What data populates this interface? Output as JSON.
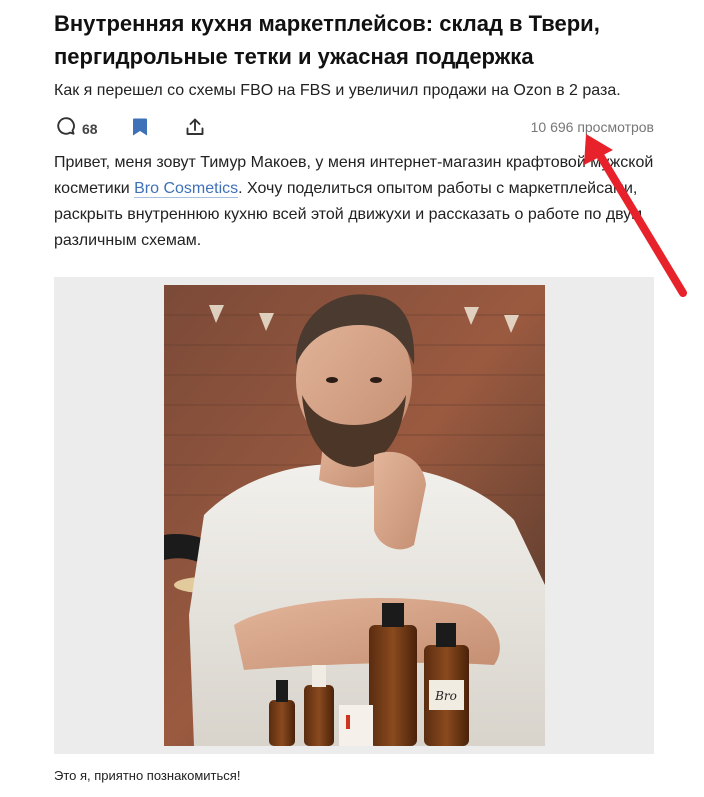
{
  "article": {
    "title": "Внутренняя кухня маркетплейсов: склад в Твери, пергидрольные тетки и ужасная поддержка",
    "subtitle": "Как я перешел со схемы FBO на FBS и увеличил продажи на Ozon в 2 раза.",
    "comments_count": "68",
    "views": "10 696 просмотров",
    "intro_before_link": "Привет, меня зовут Тимур Макоев, у меня интернет-магазин крафтовой мужской косметики ",
    "link_text": "Bro Cosmetics",
    "intro_after_link": ". Хочу поделиться опытом работы с маркетплейсами, раскрыть внутреннюю кухню всей этой движухи и рассказать о работе по двум различным схемам.",
    "photo_caption": "Это я, приятно познакомиться!",
    "product_label": "Bro"
  },
  "colors": {
    "accent": "#3f71b8",
    "annotation_arrow": "#e8222a",
    "figure_background": "#ececec"
  },
  "icons": {
    "comments": "speech-bubble-icon",
    "bookmark": "bookmark-icon",
    "share": "share-icon"
  }
}
